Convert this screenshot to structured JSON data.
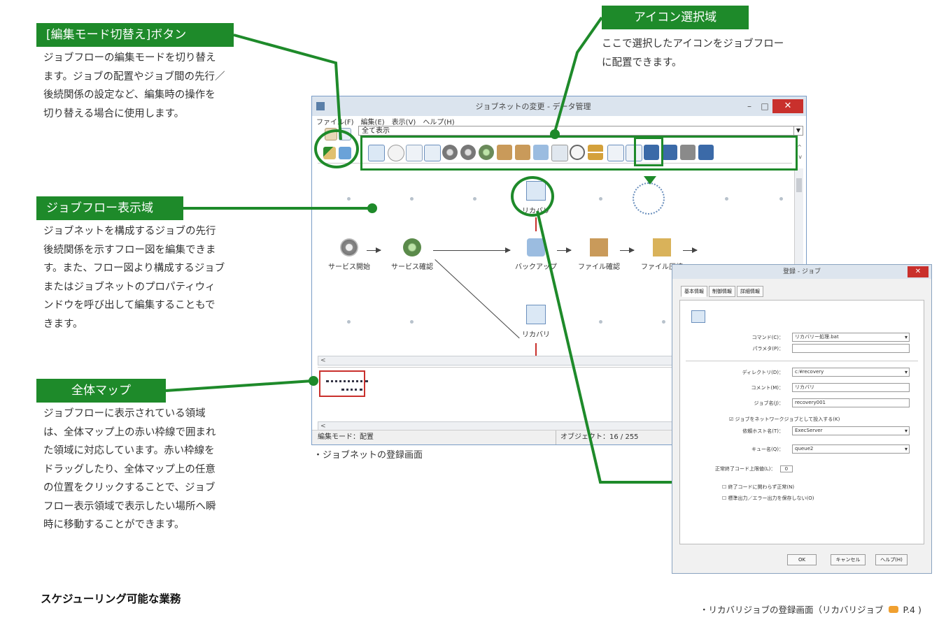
{
  "callouts": {
    "edit_mode": {
      "label": "[編集モード切替え]ボタン",
      "desc": "ジョブフローの編集モードを切り替え\nます。ジョブの配置やジョブ間の先行／\n後続関係の設定など、編集時の操作を\n切り替える場合に使用します。"
    },
    "icon_area": {
      "label": "アイコン選択域",
      "desc": "ここで選択したアイコンをジョブフロー\nに配置できます。"
    },
    "flow_area": {
      "label": "ジョブフロー表示域",
      "desc": "ジョブネットを構成するジョブの先行\n後続関係を示すフロー図を編集できま\nす。また、フロー図より構成するジョブ\nまたはジョブネットのプロパティウィ\nンドウを呼び出して編集することもで\nきます。"
    },
    "overview_map": {
      "label": "全体マップ",
      "desc": "ジョブフローに表示されている領域\nは、全体マップ上の赤い枠線で囲まれ\nた領域に対応しています。赤い枠線を\nドラッグしたり、全体マップ上の任意\nの位置をクリックすることで、ジョブ\nフロー表示領域で表示したい場所へ瞬\n時に移動することができます。"
    }
  },
  "main_window": {
    "title": "ジョブネットの変更 - データ管理",
    "menu": [
      "ファイル(F)",
      "編集(E)",
      "表示(V)",
      "ヘルプ(H)"
    ],
    "view_combo": "全て表示",
    "nodes": {
      "service_start": "サービス開始",
      "service_check": "サービス確認",
      "backup": "バックアップ",
      "file_check": "ファイル確認",
      "file_compress": "ファイル圧縮",
      "recovery_top": "リカバリ",
      "recovery_bottom": "リカバリ"
    },
    "status_mode": "編集モード：配置",
    "status_objects": "オブジェクト：16 / 255",
    "caption": "・ジョブネットの登録画面"
  },
  "job_dialog": {
    "title": "登録 - ジョブ",
    "tabs": [
      "基本情報",
      "制御情報",
      "詳細情報"
    ],
    "fields": {
      "command_label": "コマンド(C)：",
      "command_value": "リカバリー処理.bat",
      "params_label": "パラメタ(P)：",
      "params_value": "",
      "directory_label": "ディレクトリ(D)：",
      "directory_value": "c:¥recovery",
      "comment_label": "コメント(M)：",
      "comment_value": "リカバリ",
      "jobname_label": "ジョブ名(J)：",
      "jobname_value": "recovery001",
      "network_check": "ジョブをネットワークジョブとして投入する(K)",
      "host_label": "依頼ホスト名(T)：",
      "host_value": "ExecServer",
      "queue_label": "キュー名(Q)：",
      "queue_value": "queue2",
      "exitcode_label": "正常終了コード上限値(L)：",
      "exitcode_value": "0",
      "ignore_exit": "終了コードに関わらず正常(N)",
      "no_output": "標準出力／エラー出力を保存しない(O)"
    },
    "buttons": {
      "ok": "OK",
      "cancel": "キャンセル",
      "help": "ヘルプ(H)"
    },
    "caption": "・リカバリジョブの登録画面（リカバリジョブ",
    "caption_ref": "P.4 )"
  },
  "heading": "スケジューリング可能な業務",
  "colors": {
    "accent_green": "#1e8a2a",
    "red": "#c9302c"
  }
}
